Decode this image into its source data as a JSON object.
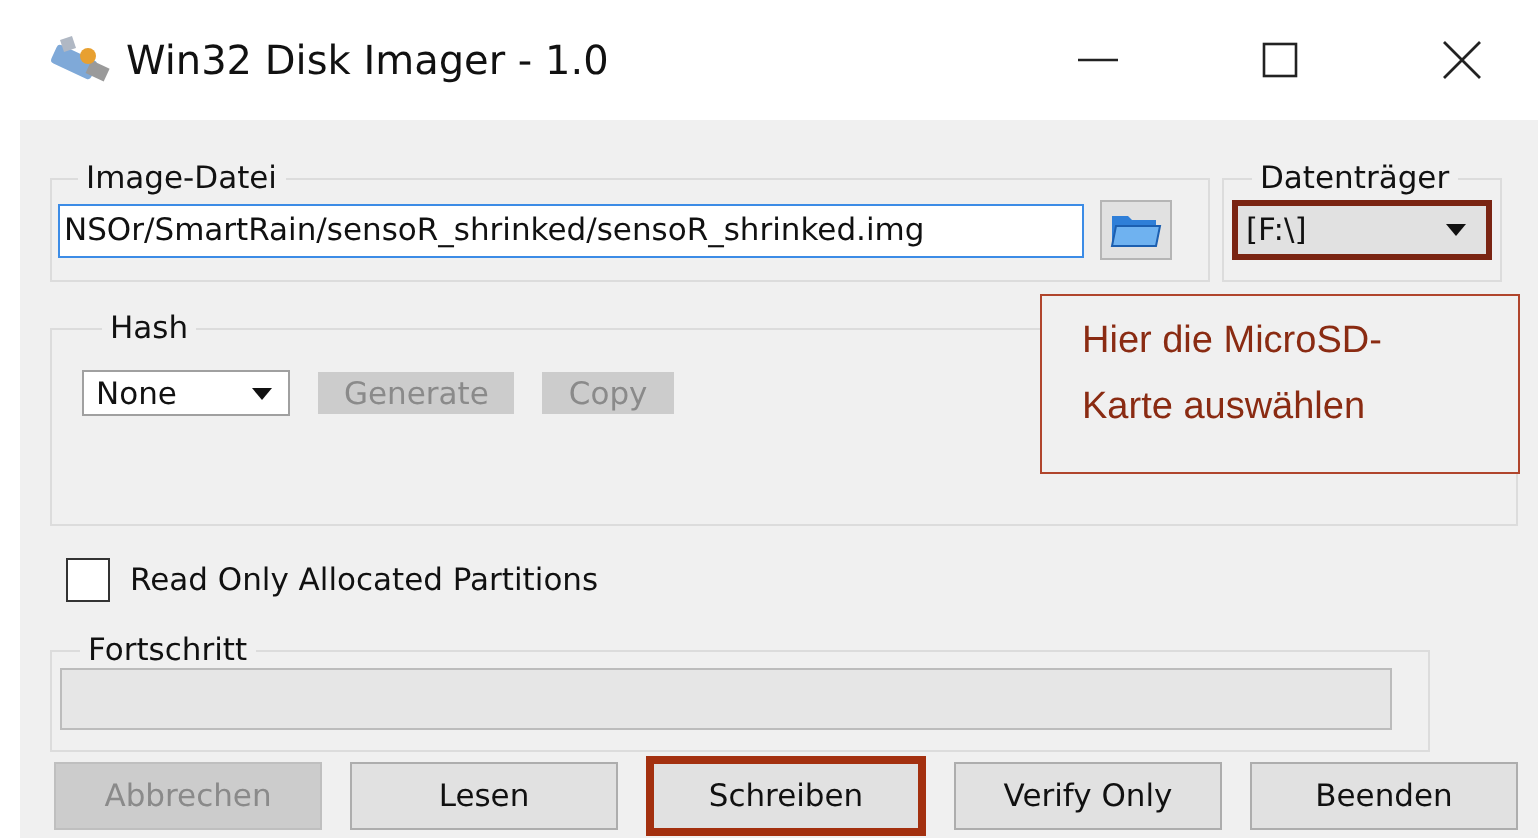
{
  "window": {
    "title": "Win32 Disk Imager - 1.0"
  },
  "image_file": {
    "label": "Image-Datei",
    "value": "NSOr/SmartRain/sensoR_shrinked/sensoR_shrinked.img"
  },
  "device": {
    "label": "Datenträger",
    "value": "[F:\\]",
    "highlighted": true
  },
  "callout": {
    "text": "Hier die MicroSD-\nKarte auswählen"
  },
  "hash": {
    "label": "Hash",
    "value": "None",
    "buttons": [
      {
        "label": "Generate",
        "disabled": true
      },
      {
        "label": "Copy",
        "disabled": true
      }
    ]
  },
  "read_only_allocated": {
    "label": "Read Only Allocated Partitions",
    "checked": false
  },
  "progress": {
    "label": "Fortschritt",
    "level": 0
  },
  "buttons": [
    {
      "label": "Abbrechen",
      "disabled": true,
      "highlighted": false
    },
    {
      "label": "Lesen",
      "disabled": false,
      "highlighted": false
    },
    {
      "label": "Schreiben",
      "disabled": false,
      "highlighted": true
    },
    {
      "label": "Verify Only",
      "disabled": false,
      "highlighted": false
    },
    {
      "label": "Beenden",
      "disabled": false,
      "highlighted": false
    }
  ]
}
